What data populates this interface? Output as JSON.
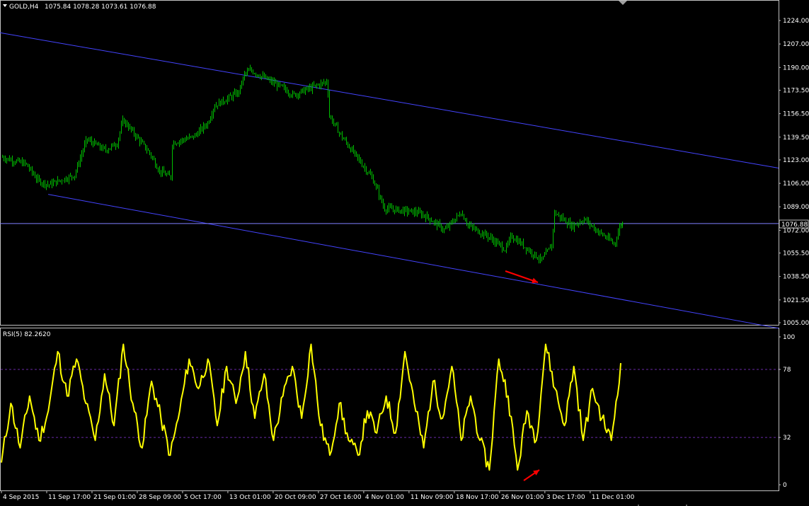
{
  "price_panel": {
    "header_symbol": "GOLD,H4",
    "header_ohlc": "1075.84 1078.28 1073.61 1076.88",
    "current_price_label": "1076.88"
  },
  "rsi_panel": {
    "header": "RSI(5) 82.2620"
  },
  "colors": {
    "background": "#000000",
    "price_bars": "#00c000",
    "channel_lines": "#4444ff",
    "rsi_line": "#ffff00",
    "rsi_levels": "#6a2aa8",
    "arrows": "#ff0000",
    "axis_text": "#ffffff",
    "frame": "#c0c0c0"
  },
  "chart_data": [
    {
      "type": "ohlc",
      "name": "GOLD,H4",
      "y_ticks": [
        1224.0,
        1207.0,
        1190.0,
        1173.5,
        1156.5,
        1139.5,
        1123.0,
        1106.0,
        1089.0,
        1072.0,
        1055.5,
        1038.5,
        1021.5,
        1005.0
      ],
      "ylim": [
        1005.0,
        1232.0
      ],
      "x_tick_labels": [
        "4 Sep 2015",
        "11 Sep 17:00",
        "21 Sep 01:00",
        "28 Sep 09:00",
        "5 Oct 17:00",
        "13 Oct 01:00",
        "20 Oct 09:00",
        "27 Oct 16:00",
        "4 Nov 01:00",
        "11 Nov 09:00",
        "18 Nov 17:00",
        "26 Nov 01:00",
        "3 Dec 17:00",
        "11 Dec 01:00"
      ],
      "approx_close_path": [
        [
          "4 Sep 2015",
          1125
        ],
        [
          "8 Sep 2015",
          1120
        ],
        [
          "10 Sep 2015",
          1108
        ],
        [
          "11 Sep 17:00",
          1105
        ],
        [
          "16 Sep 2015",
          1112
        ],
        [
          "18 Sep 2015",
          1138
        ],
        [
          "21 Sep 01:00",
          1130
        ],
        [
          "23 Sep 2015",
          1135
        ],
        [
          "24 Sep 2015",
          1152
        ],
        [
          "28 Sep 09:00",
          1128
        ],
        [
          "30 Sep 2015",
          1115
        ],
        [
          "2 Oct 2015",
          1110
        ],
        [
          "2 Oct 2015",
          1135
        ],
        [
          "5 Oct 17:00",
          1140
        ],
        [
          "8 Oct 2015",
          1150
        ],
        [
          "9 Oct 2015",
          1162
        ],
        [
          "13 Oct 01:00",
          1172
        ],
        [
          "14 Oct 2015",
          1185
        ],
        [
          "15 Oct 2015",
          1188
        ],
        [
          "20 Oct 09:00",
          1175
        ],
        [
          "22 Oct 2015",
          1170
        ],
        [
          "27 Oct 16:00",
          1180
        ],
        [
          "28 Oct 2015",
          1155
        ],
        [
          "30 Oct 2015",
          1140
        ],
        [
          "4 Nov 01:00",
          1110
        ],
        [
          "5 Nov 2015",
          1100
        ],
        [
          "6 Nov 2015",
          1088
        ],
        [
          "11 Nov 09:00",
          1085
        ],
        [
          "13 Nov 2015",
          1082
        ],
        [
          "16 Nov 2015",
          1072
        ],
        [
          "18 Nov 17:00",
          1085
        ],
        [
          "20 Nov 2015",
          1075
        ],
        [
          "23 Nov 2015",
          1068
        ],
        [
          "26 Nov 01:00",
          1058
        ],
        [
          "27 Nov 2015",
          1068
        ],
        [
          "2 Dec 2015",
          1050
        ],
        [
          "3 Dec 17:00",
          1062
        ],
        [
          "4 Dec 2015",
          1085
        ],
        [
          "7 Dec 2015",
          1075
        ],
        [
          "9 Dec 2015",
          1080
        ],
        [
          "11 Dec 01:00",
          1072
        ],
        [
          "14 Dec 2015",
          1062
        ],
        [
          "15 Dec 2015",
          1076.88
        ]
      ],
      "last_bar": {
        "open": 1075.84,
        "high": 1078.28,
        "low": 1073.61,
        "close": 1076.88
      },
      "horizontal_line": 1076.88,
      "channel": {
        "upper": [
          [
            "4 Sep 2015",
            1215
          ],
          [
            "15 Dec 2015",
            1137
          ]
        ],
        "lower": [
          [
            "11 Sep 17:00",
            1098
          ],
          [
            "15 Dec 2015",
            1022
          ]
        ]
      },
      "annotation": "red arrow pointing down-right below the Dec 2 low"
    },
    {
      "type": "line",
      "name": "RSI(5)",
      "ylim": [
        0,
        100
      ],
      "y_ticks": [
        0,
        32,
        78,
        100
      ],
      "levels": [
        32,
        78
      ],
      "last_value": 82.262,
      "approx_values": [
        15,
        55,
        25,
        60,
        30,
        50,
        90,
        60,
        85,
        55,
        30,
        75,
        40,
        95,
        55,
        25,
        70,
        45,
        20,
        50,
        85,
        65,
        85,
        40,
        80,
        55,
        90,
        45,
        75,
        30,
        60,
        80,
        45,
        95,
        40,
        20,
        55,
        30,
        20,
        50,
        35,
        60,
        35,
        90,
        55,
        25,
        70,
        45,
        80,
        30,
        60,
        30,
        10,
        85,
        60,
        10,
        50,
        30,
        95,
        65,
        40,
        80,
        30,
        65,
        45,
        30,
        82
      ],
      "annotation": "red arrow pointing up-right toward the late-Nov RSI low"
    }
  ]
}
